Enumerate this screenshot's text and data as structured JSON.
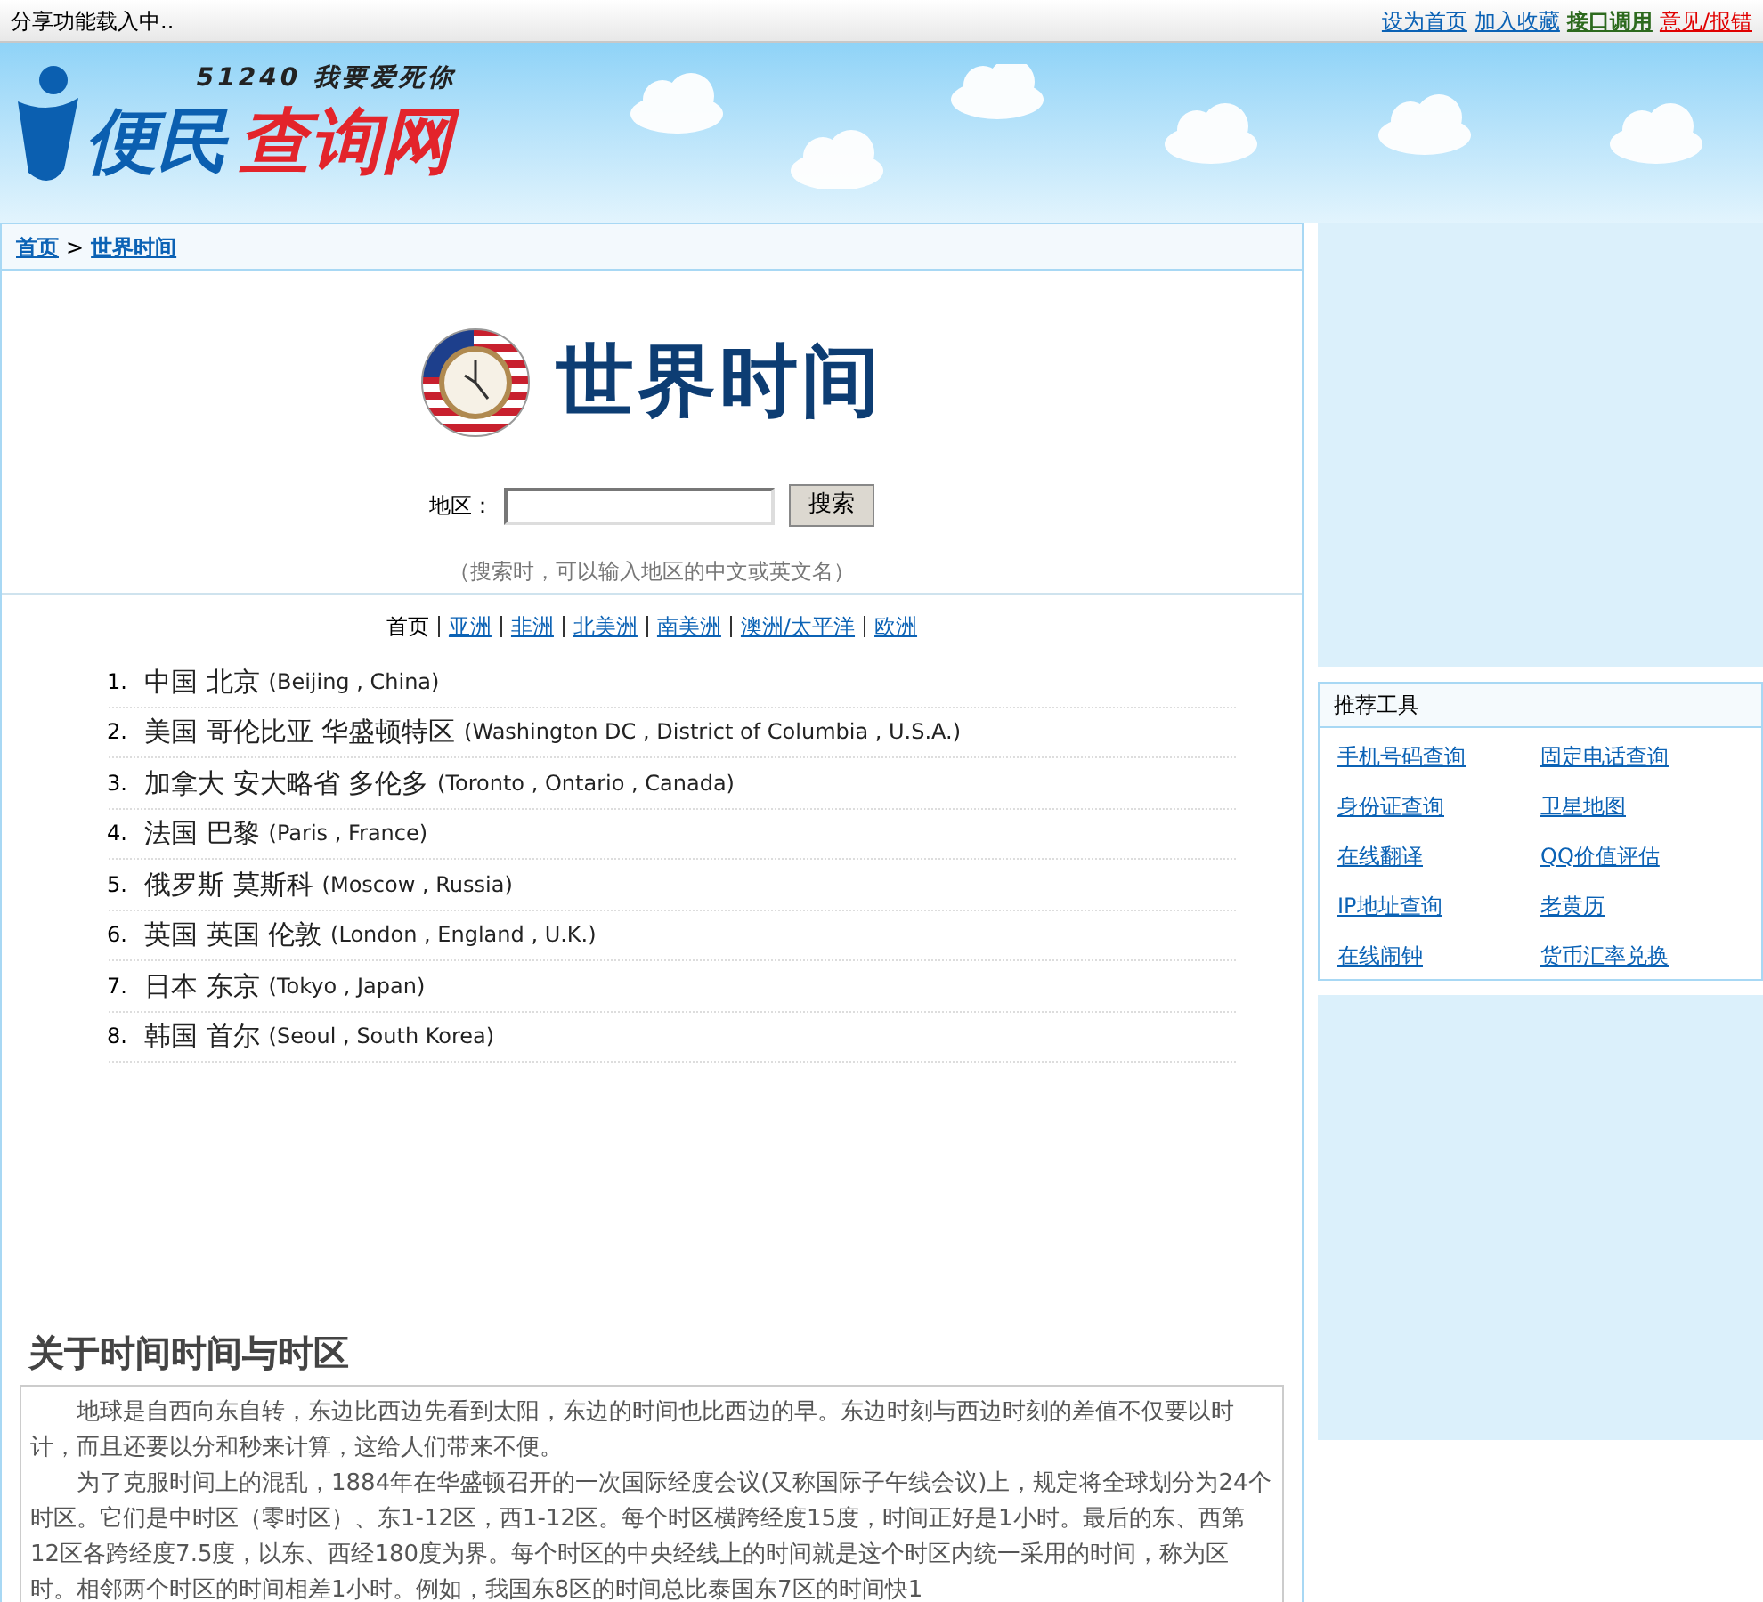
{
  "top_bar": {
    "status": "分享功能载入中..",
    "links": [
      {
        "label": "设为首页",
        "kind": "blue"
      },
      {
        "label": "加入收藏",
        "kind": "blue"
      },
      {
        "label": "接口调用",
        "kind": "green"
      },
      {
        "label": "意见/报错",
        "kind": "red"
      }
    ]
  },
  "logo": {
    "slogan": "51240 我要爱死你",
    "name_part_1": "便民",
    "name_part_2": "查询网"
  },
  "breadcrumb": [
    "首页",
    "世界时间"
  ],
  "breadcrumb_separator": ">",
  "title": "世界时间",
  "search": {
    "label": "地区：",
    "button": "搜索",
    "hint": "（搜索时，可以输入地区的中文或英文名）"
  },
  "regions": [
    {
      "label": "首页",
      "selected": true
    },
    {
      "label": "亚洲",
      "selected": false
    },
    {
      "label": "非洲",
      "selected": false
    },
    {
      "label": "北美洲",
      "selected": false
    },
    {
      "label": "南美洲",
      "selected": false
    },
    {
      "label": "澳洲/太平洋",
      "selected": false
    },
    {
      "label": "欧洲",
      "selected": false
    }
  ],
  "cities": [
    {
      "number": "1.",
      "name": "中国 北京",
      "english": "(Beijing , China)"
    },
    {
      "number": "2.",
      "name": "美国 哥伦比亚 华盛顿特区",
      "english": "(Washington DC , District of Columbia , U.S.A.)"
    },
    {
      "number": "3.",
      "name": "加拿大 安大略省 多伦多",
      "english": "(Toronto , Ontario , Canada)"
    },
    {
      "number": "4.",
      "name": "法国 巴黎",
      "english": "(Paris , France)"
    },
    {
      "number": "5.",
      "name": "俄罗斯 莫斯科",
      "english": "(Moscow , Russia)"
    },
    {
      "number": "6.",
      "name": "英国 英国 伦敦",
      "english": "(London , England , U.K.)"
    },
    {
      "number": "7.",
      "name": "日本 东京",
      "english": "(Tokyo , Japan)"
    },
    {
      "number": "8.",
      "name": "韩国 首尔",
      "english": "(Seoul , South Korea)"
    }
  ],
  "about": {
    "heading": "关于时间时间与时区",
    "paragraphs": [
      "地球是自西向东自转，东边比西边先看到太阳，东边的时间也比西边的早。东边时刻与西边时刻的差值不仅要以时计，而且还要以分和秒来计算，这给人们带来不便。",
      "为了克服时间上的混乱，1884年在华盛顿召开的一次国际经度会议(又称国际子午线会议)上，规定将全球划分为24个时区。它们是中时区（零时区）、东1-12区，西1-12区。每个时区横跨经度15度，时间正好是1小时。最后的东、西第12区各跨经度7.5度，以东、西经180度为界。每个时区的中央经线上的时间就是这个时区内统一采用的时间，称为区时。相邻两个时区的时间相差1小时。例如，我国东8区的时间总比泰国东7区的时间快1"
    ]
  },
  "tools": {
    "title": "推荐工具",
    "items": [
      "手机号码查询",
      "固定电话查询",
      "身份证查询",
      "卫星地图",
      "在线翻译",
      "QQ价值评估",
      "IP地址查询",
      "老黄历",
      "在线闹钟",
      "货币汇率兑换"
    ]
  }
}
